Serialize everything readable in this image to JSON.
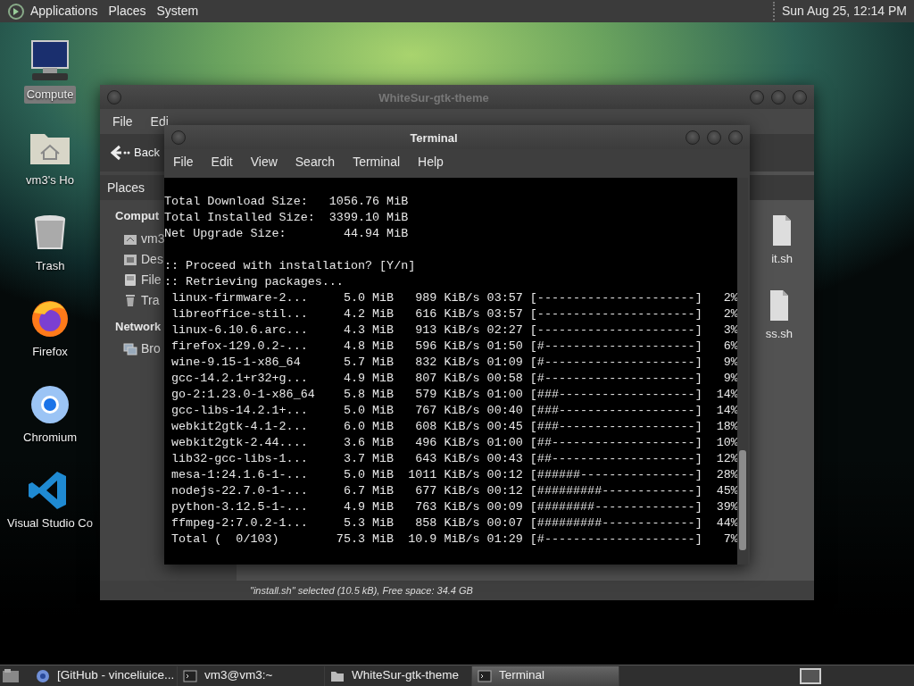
{
  "top_panel": {
    "menus": [
      "Applications",
      "Places",
      "System"
    ],
    "clock": "Sun Aug 25, 12:14 PM"
  },
  "desktop_icons": [
    {
      "label": "Compute",
      "kind": "computer",
      "selected": true
    },
    {
      "label": "vm3's Ho",
      "kind": "home",
      "selected": false
    },
    {
      "label": "Trash",
      "kind": "trash",
      "selected": false
    },
    {
      "label": "Firefox",
      "kind": "firefox",
      "selected": false
    },
    {
      "label": "Chromium",
      "kind": "chromium",
      "selected": false
    },
    {
      "label": "Visual Studio Co",
      "kind": "vscode",
      "selected": false
    }
  ],
  "file_manager": {
    "title": "WhiteSur-gtk-theme",
    "menus": [
      "File",
      "Edi"
    ],
    "back": "Back",
    "sidebar": {
      "header": "Places",
      "groups": [
        {
          "title": "Comput",
          "items": [
            {
              "label": "vm3",
              "kind": "home"
            },
            {
              "label": "Des",
              "kind": "desktop"
            },
            {
              "label": "File",
              "kind": "drive"
            },
            {
              "label": "Tra",
              "kind": "trash"
            }
          ]
        },
        {
          "title": "Network",
          "items": [
            {
              "label": "Bro",
              "kind": "network"
            }
          ]
        }
      ]
    },
    "files": [
      {
        "label": "it.sh"
      },
      {
        "label": "ss.sh"
      }
    ],
    "status": "\"install.sh\" selected (10.5 kB), Free space: 34.4 GB"
  },
  "terminal": {
    "title": "Terminal",
    "menus": [
      "File",
      "Edit",
      "View",
      "Search",
      "Terminal",
      "Help"
    ],
    "sections": [
      {
        "lines": [
          "Total Download Size:   1056.76 MiB",
          "Total Installed Size:  3399.10 MiB",
          "Net Upgrade Size:        44.94 MiB"
        ]
      },
      {
        "lines": [
          ":: Proceed with installation? [Y/n]",
          ":: Retrieving packages...",
          " linux-firmware-2...     5.0 MiB   989 KiB/s 03:57 [----------------------]   2%",
          " libreoffice-stil...     4.2 MiB   616 KiB/s 03:57 [----------------------]   2%",
          " linux-6.10.6.arc...     4.3 MiB   913 KiB/s 02:27 [----------------------]   3%",
          " firefox-129.0.2-...     4.8 MiB   596 KiB/s 01:50 [#---------------------]   6%",
          " wine-9.15-1-x86_64      5.7 MiB   832 KiB/s 01:09 [#---------------------]   9%",
          " gcc-14.2.1+r32+g...     4.9 MiB   807 KiB/s 00:58 [#---------------------]   9%",
          " go-2:1.23.0-1-x86_64    5.8 MiB   579 KiB/s 01:00 [###-------------------]  14%",
          " gcc-libs-14.2.1+...     5.0 MiB   767 KiB/s 00:40 [###-------------------]  14%",
          " webkit2gtk-4.1-2...     6.0 MiB   608 KiB/s 00:45 [###-------------------]  18%",
          " webkit2gtk-2.44....     3.6 MiB   496 KiB/s 01:00 [##--------------------]  10%",
          " lib32-gcc-libs-1...     3.7 MiB   643 KiB/s 00:43 [##--------------------]  12%",
          " mesa-1:24.1.6-1-...     5.0 MiB  1011 KiB/s 00:12 [######----------------]  28%",
          " nodejs-22.7.0-1-...     6.7 MiB   677 KiB/s 00:12 [#########-------------]  45%",
          " python-3.12.5-1-...     4.9 MiB   763 KiB/s 00:09 [########--------------]  39%",
          " ffmpeg-2:7.0.2-1...     5.3 MiB   858 KiB/s 00:07 [#########-------------]  44%",
          " Total (  0/103)        75.3 MiB  10.9 MiB/s 01:29 [#---------------------]   7%"
        ]
      }
    ]
  },
  "taskbar": {
    "items": [
      {
        "label": "[GitHub - vinceliuice...",
        "kind": "browser",
        "selected": false
      },
      {
        "label": "vm3@vm3:~",
        "kind": "terminal",
        "selected": false
      },
      {
        "label": "WhiteSur-gtk-theme",
        "kind": "folder",
        "selected": false
      },
      {
        "label": "Terminal",
        "kind": "terminal",
        "selected": true
      }
    ]
  }
}
